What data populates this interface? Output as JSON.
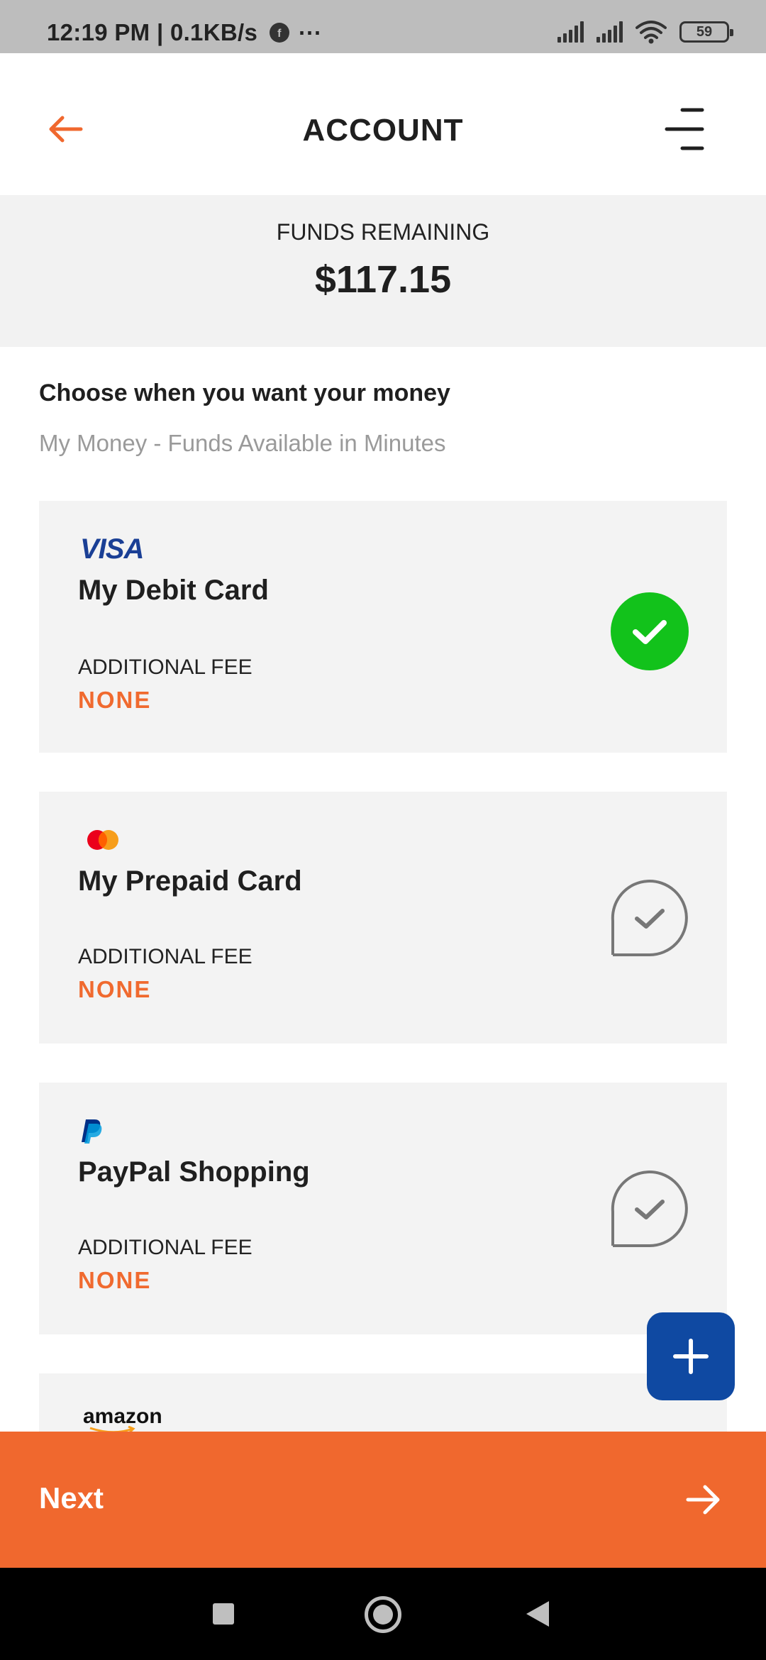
{
  "status_bar": {
    "time": "12:19 PM | 0.1KB/s",
    "extra_icons": "⋯",
    "battery": "59"
  },
  "header": {
    "title": "ACCOUNT",
    "back_icon": "back-arrow-icon",
    "menu_icon": "menu-icon"
  },
  "funds": {
    "label": "FUNDS REMAINING",
    "amount": "$117.15"
  },
  "section": {
    "title": "Choose when you want your money",
    "subtitle": "My Money - Funds Available in Minutes"
  },
  "cards": [
    {
      "logo": "VISA",
      "name": "My Debit Card",
      "fee_label": "ADDITIONAL FEE",
      "fee_value": "NONE",
      "selected": true
    },
    {
      "logo": "mastercard-logo",
      "name": "My Prepaid Card",
      "fee_label": "ADDITIONAL FEE",
      "fee_value": "NONE",
      "selected": false
    },
    {
      "logo": "paypal-logo",
      "name": "PayPal Shopping",
      "fee_label": "ADDITIONAL FEE",
      "fee_value": "NONE",
      "selected": false
    },
    {
      "logo": "amazon",
      "name": "",
      "fee_label": "",
      "fee_value": "",
      "selected": false
    }
  ],
  "fab": {
    "icon": "plus-icon"
  },
  "footer": {
    "next_label": "Next",
    "next_icon": "arrow-right-icon"
  },
  "colors": {
    "accent": "#f0682e",
    "selected": "#12c21b",
    "fab": "#0f49a2",
    "card_bg": "#f3f3f3"
  }
}
